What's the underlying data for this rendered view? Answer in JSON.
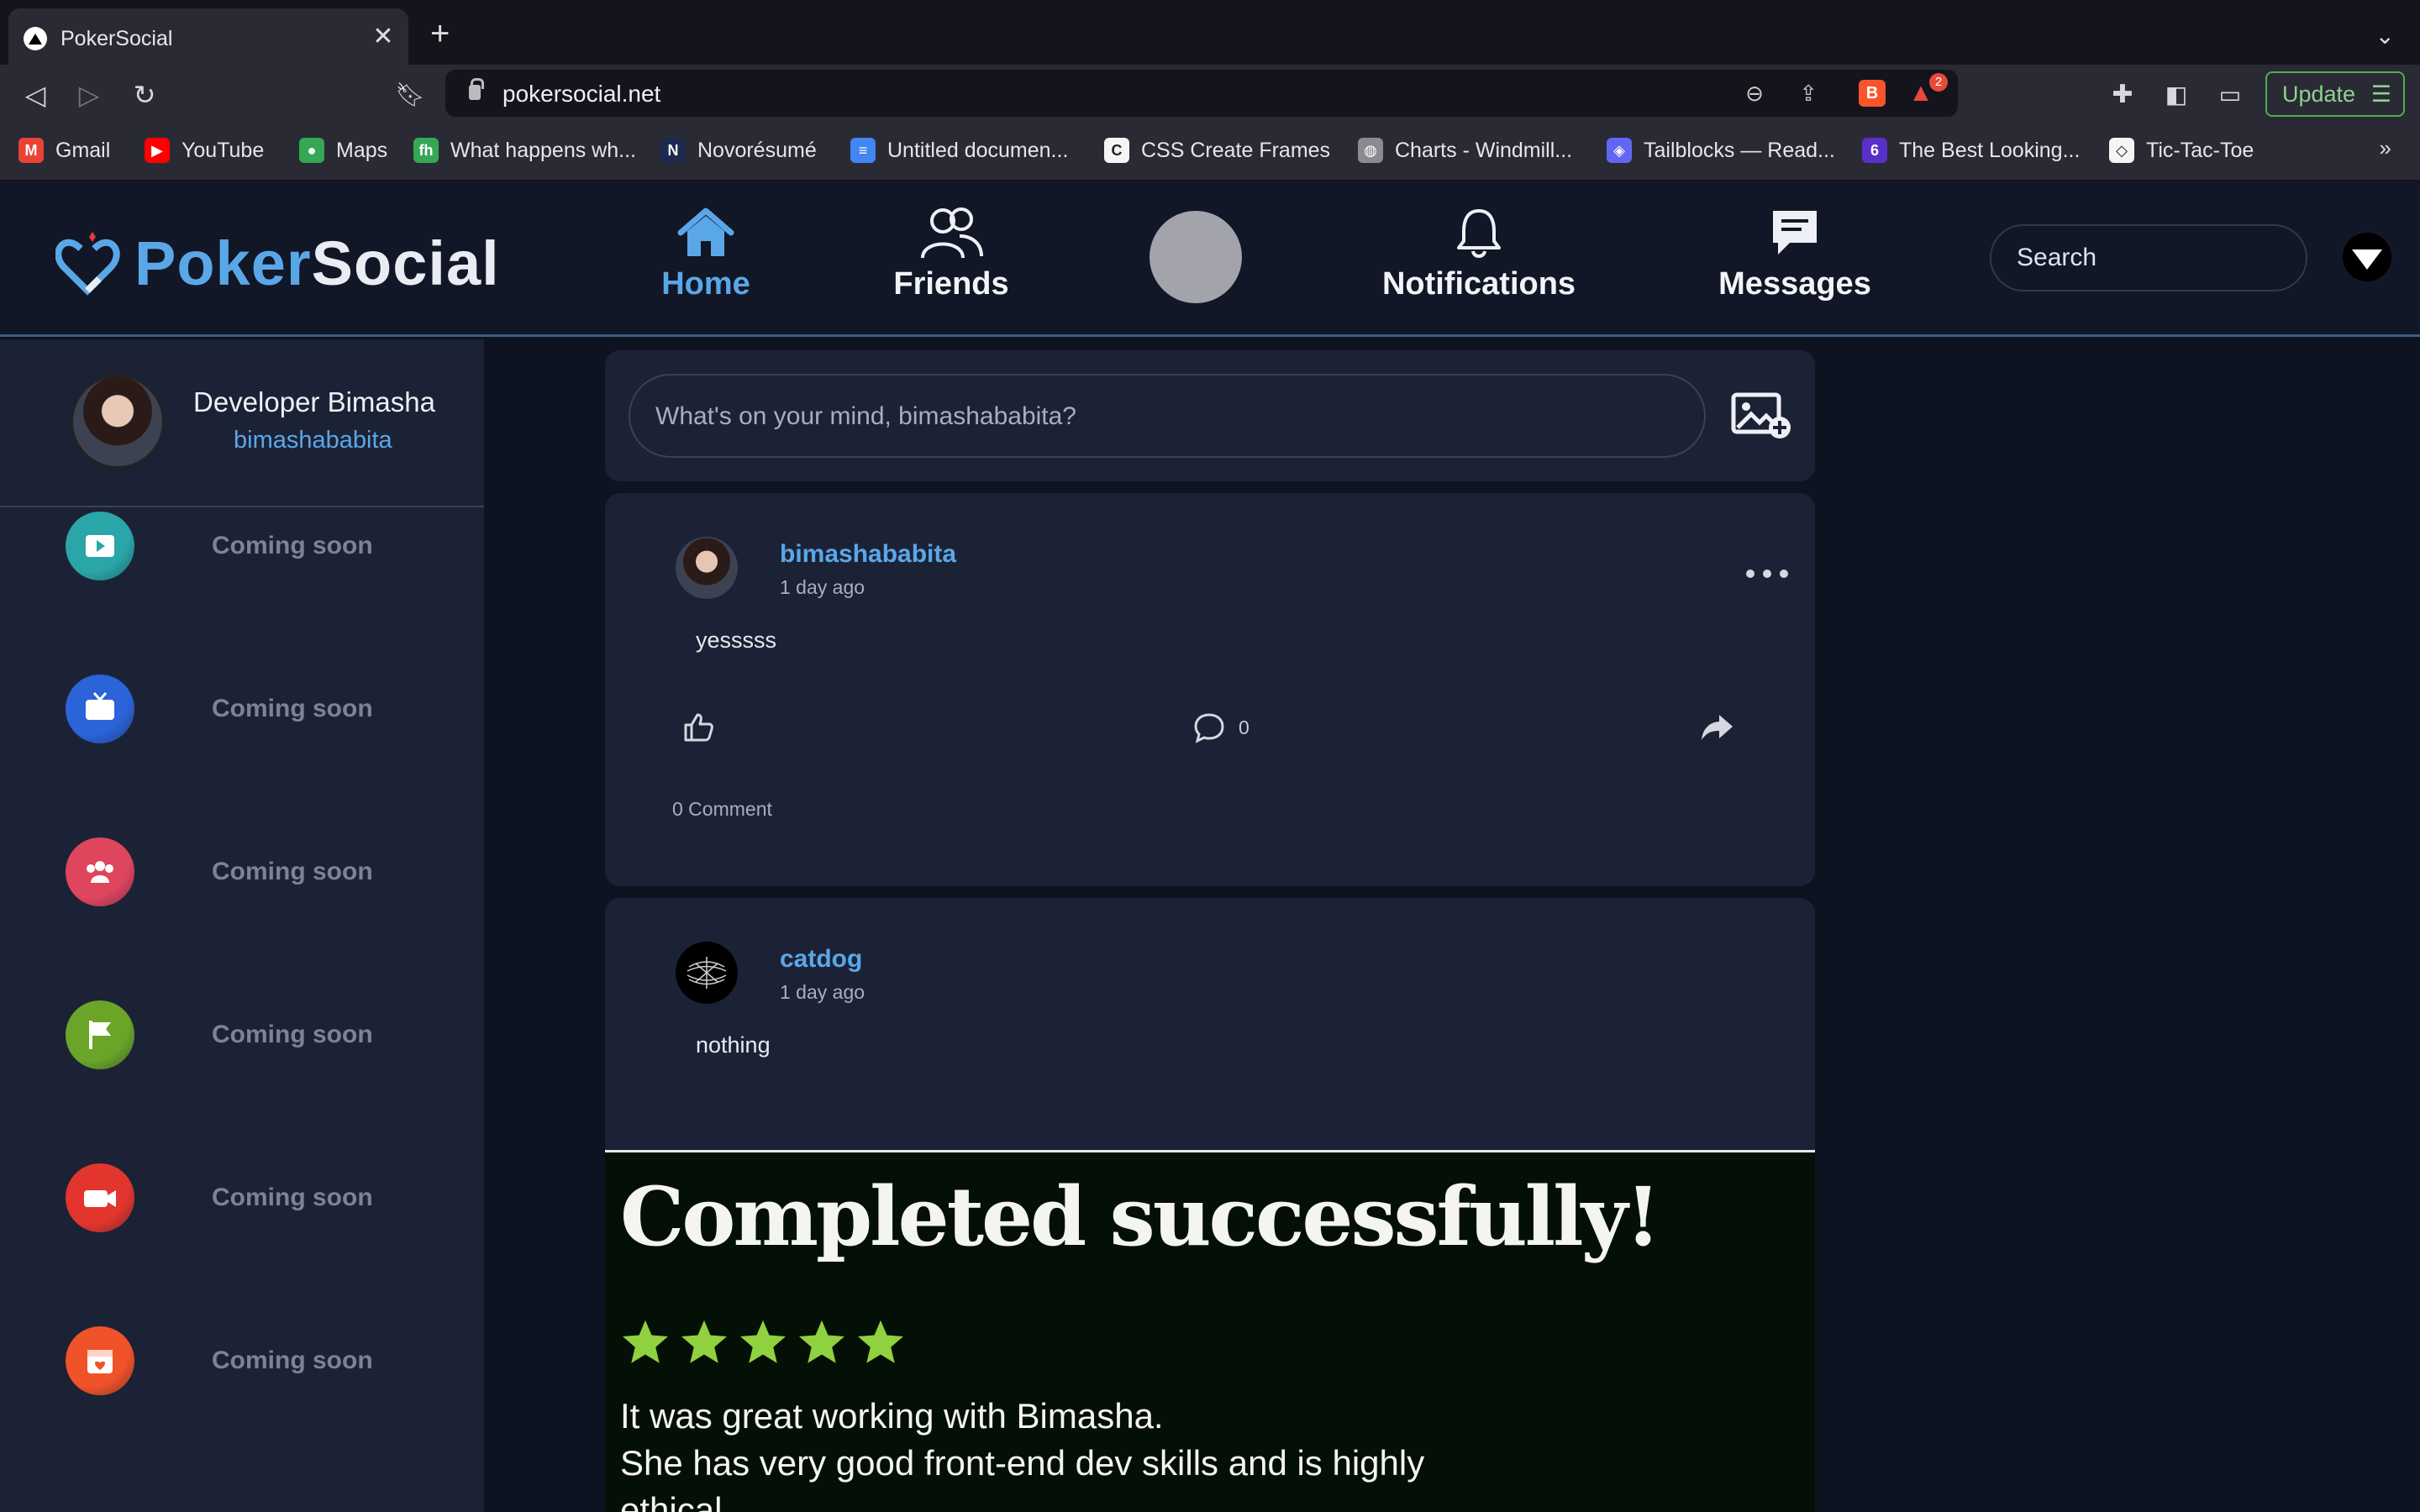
{
  "browser": {
    "tab_title": "PokerSocial",
    "url": "pokersocial.net",
    "update_label": "Update",
    "rewards_badge": "2",
    "bookmarks": [
      {
        "label": "Gmail",
        "icon": "gmail-icon",
        "color": "#ea4335"
      },
      {
        "label": "YouTube",
        "icon": "youtube-icon",
        "color": "#ff0000"
      },
      {
        "label": "Maps",
        "icon": "maps-icon",
        "color": "#34a853"
      },
      {
        "label": "What happens wh...",
        "icon": "fh-icon",
        "color": "#35a857"
      },
      {
        "label": "Novorésumé",
        "icon": "novoresume-icon",
        "color": "#1b2a4e"
      },
      {
        "label": "Untitled documen...",
        "icon": "docs-icon",
        "color": "#4285f4"
      },
      {
        "label": "CSS Create Frames",
        "icon": "frames-icon",
        "color": "#f5f5f5"
      },
      {
        "label": "Charts - Windmill...",
        "icon": "globe-icon",
        "color": "#8a8a92"
      },
      {
        "label": "Tailblocks — Read...",
        "icon": "tailblocks-icon",
        "color": "#6366f1"
      },
      {
        "label": "The Best Looking...",
        "icon": "six-icon",
        "color": "#5b2fc9"
      },
      {
        "label": "Tic-Tac-Toe",
        "icon": "codepen-icon",
        "color": "#f5f5f5"
      }
    ]
  },
  "header": {
    "logo": {
      "part1": "Poker",
      "part2": "Social"
    },
    "nav": {
      "home": "Home",
      "friends": "Friends",
      "notifications": "Notifications",
      "messages": "Messages"
    },
    "search_placeholder": "Search"
  },
  "sidebar": {
    "profile": {
      "name": "Developer Bimasha",
      "handle": "bimashababita"
    },
    "items": [
      {
        "label": "Coming soon",
        "icon": "video-icon",
        "color": "#2aa6a8"
      },
      {
        "label": "Coming soon",
        "icon": "tv-icon",
        "color": "#2b63d9"
      },
      {
        "label": "Coming soon",
        "icon": "groups-icon",
        "color": "#e0455e"
      },
      {
        "label": "Coming soon",
        "icon": "flag-icon",
        "color": "#6aa528"
      },
      {
        "label": "Coming soon",
        "icon": "camera-icon",
        "color": "#e2352d"
      },
      {
        "label": "Coming soon",
        "icon": "calendar-icon",
        "color": "#f0522a"
      }
    ]
  },
  "composer": {
    "placeholder": "What's on your mind, bimashababita?"
  },
  "posts": [
    {
      "author": "bimashababita",
      "time": "1 day ago",
      "body": "yesssss",
      "comment_count": "0",
      "comments_label": "0 Comment"
    },
    {
      "author": "catdog",
      "time": "1 day ago",
      "body": "nothing"
    }
  ],
  "review_image": {
    "title": "Completed successfully!",
    "rating": 5,
    "line1": "It was great working with Bimasha.",
    "line2": "She has very good front-end dev skills and is highly",
    "line3": "ethical."
  }
}
